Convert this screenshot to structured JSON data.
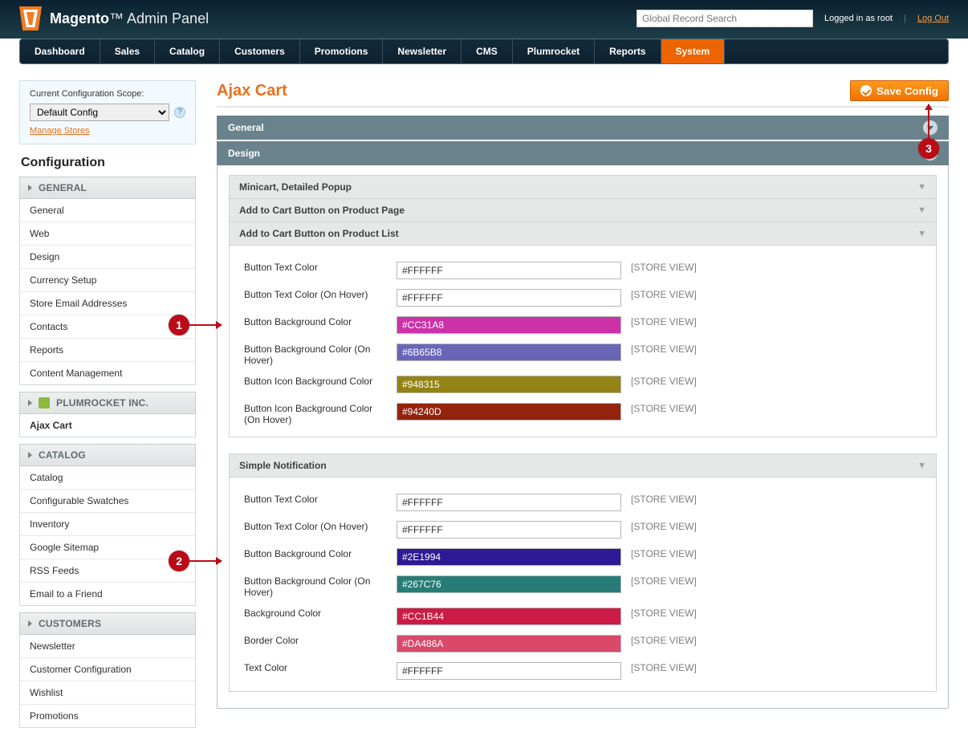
{
  "header": {
    "brand1": "Magento",
    "brand2": "Admin Panel",
    "search_placeholder": "Global Record Search",
    "logged_text": "Logged in as root",
    "logout": "Log Out"
  },
  "nav": [
    "Dashboard",
    "Sales",
    "Catalog",
    "Customers",
    "Promotions",
    "Newsletter",
    "CMS",
    "Plumrocket",
    "Reports",
    "System"
  ],
  "nav_active_index": 9,
  "scope": {
    "label": "Current Configuration Scope:",
    "selected": "Default Config",
    "manage": "Manage Stores"
  },
  "config_title": "Configuration",
  "side": {
    "general_head": "GENERAL",
    "general_items": [
      "General",
      "Web",
      "Design",
      "Currency Setup",
      "Store Email Addresses",
      "Contacts",
      "Reports",
      "Content Management"
    ],
    "plum_head": "PLUMROCKET INC.",
    "plum_items": [
      "Ajax Cart"
    ],
    "catalog_head": "CATALOG",
    "catalog_items": [
      "Catalog",
      "Configurable Swatches",
      "Inventory",
      "Google Sitemap",
      "RSS Feeds",
      "Email to a Friend"
    ],
    "customers_head": "CUSTOMERS",
    "customers_items": [
      "Newsletter",
      "Customer Configuration",
      "Wishlist",
      "Promotions"
    ]
  },
  "page_title": "Ajax Cart",
  "save_label": "Save Config",
  "acc_general": "General",
  "acc_design": "Design",
  "sub1": "Minicart, Detailed Popup",
  "sub2": "Add to Cart Button on Product Page",
  "sub3": "Add to Cart Button on Product List",
  "sub4": "Simple Notification",
  "scope_tag": "[STORE VIEW]",
  "rows3": [
    {
      "label": "Button Text Color",
      "value": "#FFFFFF",
      "bg": "#ffffff",
      "fg": "#2f2f2f"
    },
    {
      "label": "Button Text Color (On Hover)",
      "value": "#FFFFFF",
      "bg": "#ffffff",
      "fg": "#2f2f2f"
    },
    {
      "label": "Button Background Color",
      "value": "#CC31A8",
      "bg": "#cc31a8",
      "fg": "#ffffff"
    },
    {
      "label": "Button Background Color (On Hover)",
      "value": "#6B65B8",
      "bg": "#6b65b8",
      "fg": "#ffffff"
    },
    {
      "label": "Button Icon Background Color",
      "value": "#948315",
      "bg": "#948315",
      "fg": "#ffffff"
    },
    {
      "label": "Button Icon Background Color (On Hover)",
      "value": "#94240D",
      "bg": "#94240d",
      "fg": "#ffffff"
    }
  ],
  "rows4": [
    {
      "label": "Button Text Color",
      "value": "#FFFFFF",
      "bg": "#ffffff",
      "fg": "#2f2f2f"
    },
    {
      "label": "Button Text Color (On Hover)",
      "value": "#FFFFFF",
      "bg": "#ffffff",
      "fg": "#2f2f2f"
    },
    {
      "label": "Button Background Color",
      "value": "#2E1994",
      "bg": "#2e1994",
      "fg": "#ffffff"
    },
    {
      "label": "Button Background Color (On Hover)",
      "value": "#267C76",
      "bg": "#267c76",
      "fg": "#ffffff"
    },
    {
      "label": "Background Color",
      "value": "#CC1B44",
      "bg": "#cc1b44",
      "fg": "#ffffff"
    },
    {
      "label": "Border Color",
      "value": "#DA486A",
      "bg": "#da486a",
      "fg": "#ffffff"
    },
    {
      "label": "Text Color",
      "value": "#FFFFFF",
      "bg": "#ffffff",
      "fg": "#2f2f2f"
    }
  ],
  "callouts": {
    "c1": "1",
    "c2": "2",
    "c3": "3"
  }
}
